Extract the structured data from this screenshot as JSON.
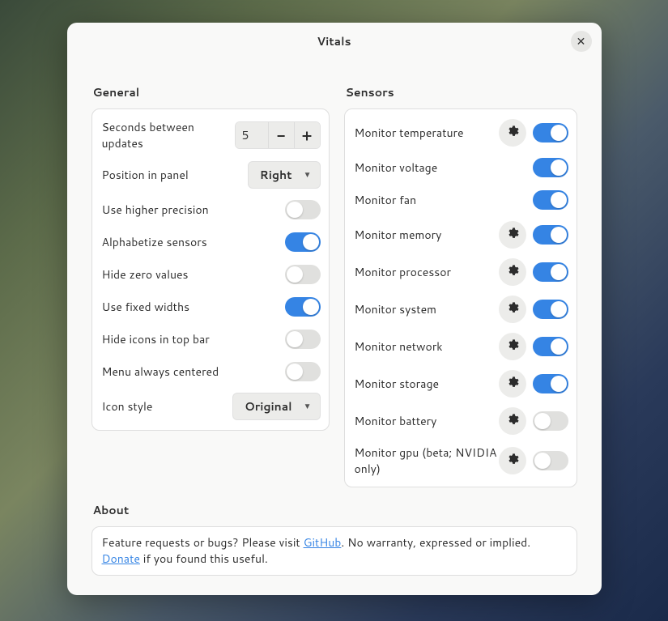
{
  "window": {
    "title": "Vitals"
  },
  "general": {
    "heading": "General",
    "seconds_label": "Seconds between updates",
    "seconds_value": "5",
    "position_label": "Position in panel",
    "position_value": "Right",
    "higher_precision_label": "Use higher precision",
    "higher_precision_on": false,
    "alphabetize_label": "Alphabetize sensors",
    "alphabetize_on": true,
    "hide_zero_label": "Hide zero values",
    "hide_zero_on": false,
    "fixed_widths_label": "Use fixed widths",
    "fixed_widths_on": true,
    "hide_icons_label": "Hide icons in top bar",
    "hide_icons_on": false,
    "menu_centered_label": "Menu always centered",
    "menu_centered_on": false,
    "icon_style_label": "Icon style",
    "icon_style_value": "Original"
  },
  "sensors": {
    "heading": "Sensors",
    "items": [
      {
        "label": "Monitor temperature",
        "gear": true,
        "on": true
      },
      {
        "label": "Monitor voltage",
        "gear": false,
        "on": true
      },
      {
        "label": "Monitor fan",
        "gear": false,
        "on": true
      },
      {
        "label": "Monitor memory",
        "gear": true,
        "on": true
      },
      {
        "label": "Monitor processor",
        "gear": true,
        "on": true
      },
      {
        "label": "Monitor system",
        "gear": true,
        "on": true
      },
      {
        "label": "Monitor network",
        "gear": true,
        "on": true
      },
      {
        "label": "Monitor storage",
        "gear": true,
        "on": true
      },
      {
        "label": "Monitor battery",
        "gear": true,
        "on": false
      },
      {
        "label": "Monitor gpu (beta; NVIDIA only)",
        "gear": true,
        "on": false
      }
    ]
  },
  "about": {
    "heading": "About",
    "text_prefix": "Feature requests or bugs? Please visit ",
    "link1": "GitHub",
    "text_mid": ". No warranty, expressed or implied. ",
    "link2": "Donate",
    "text_suffix": " if you found this useful."
  }
}
